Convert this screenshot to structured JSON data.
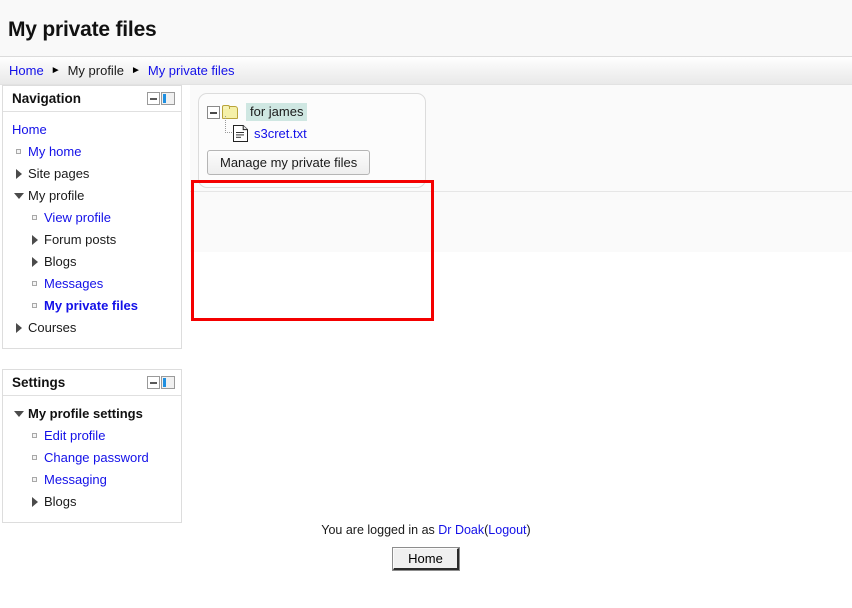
{
  "page": {
    "title": "My private files"
  },
  "breadcrumb": {
    "separator": "►",
    "items": [
      {
        "label": "Home",
        "is_link": true
      },
      {
        "label": "My profile",
        "is_link": false
      },
      {
        "label": "My private files",
        "is_link": true
      }
    ]
  },
  "blocks": {
    "navigation": {
      "title": "Navigation",
      "hide_icon": "minus-box-icon",
      "dock_icon": "dock-icon",
      "root_label": "Home",
      "items": [
        {
          "label": "My home",
          "marker": "leaf",
          "indent": 0,
          "style": "link"
        },
        {
          "label": "Site pages",
          "marker": "closed",
          "indent": 0,
          "style": "plain"
        },
        {
          "label": "My profile",
          "marker": "open",
          "indent": 0,
          "style": "plain"
        },
        {
          "label": "View profile",
          "marker": "leaf",
          "indent": 1,
          "style": "link"
        },
        {
          "label": "Forum posts",
          "marker": "closed",
          "indent": 1,
          "style": "plain"
        },
        {
          "label": "Blogs",
          "marker": "closed",
          "indent": 1,
          "style": "plain"
        },
        {
          "label": "Messages",
          "marker": "leaf",
          "indent": 1,
          "style": "link"
        },
        {
          "label": "My private files",
          "marker": "leaf",
          "indent": 1,
          "style": "current"
        },
        {
          "label": "Courses",
          "marker": "closed",
          "indent": 0,
          "style": "plain"
        }
      ]
    },
    "settings": {
      "title": "Settings",
      "hide_icon": "minus-box-icon",
      "dock_icon": "dock-icon",
      "items": [
        {
          "label": "My profile settings",
          "marker": "open",
          "indent": 0,
          "style": "bold-dark"
        },
        {
          "label": "Edit profile",
          "marker": "leaf",
          "indent": 1,
          "style": "link"
        },
        {
          "label": "Change password",
          "marker": "leaf",
          "indent": 1,
          "style": "link"
        },
        {
          "label": "Messaging",
          "marker": "leaf",
          "indent": 1,
          "style": "link"
        },
        {
          "label": "Blogs",
          "marker": "closed",
          "indent": 1,
          "style": "plain"
        }
      ]
    }
  },
  "filemanager": {
    "folder": {
      "name": "for james",
      "toggle_icon": "collapse-minus-icon",
      "folder_icon": "folder-open-icon",
      "selected": true
    },
    "file": {
      "name": "s3cret.txt",
      "file_icon": "text-file-icon"
    },
    "manage_button_label": "Manage my private files"
  },
  "annotation": {
    "color": "#f40000"
  },
  "footer": {
    "logged_in_prefix": "You are logged in as ",
    "user_name": "Dr Doak",
    "paren_open": "(",
    "logout_label": "Logout",
    "paren_close": ")",
    "home_button_label": "Home"
  }
}
